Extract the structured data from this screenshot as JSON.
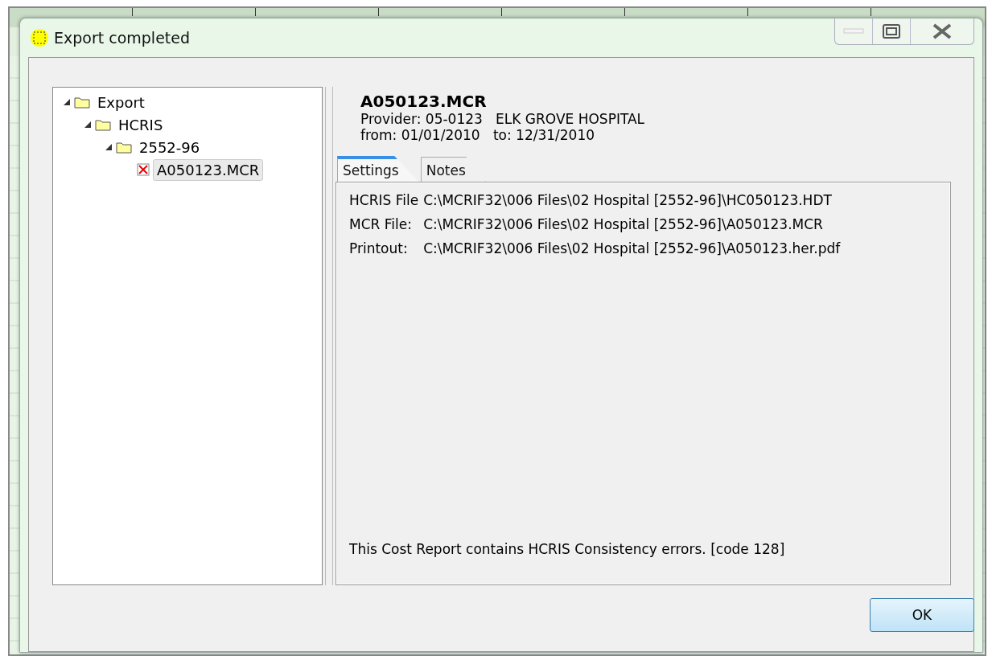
{
  "window": {
    "title": "Export completed"
  },
  "tree": [
    {
      "label": "Export",
      "kind": "folder",
      "expanded": true,
      "selected": false,
      "children": [
        {
          "label": "HCRIS",
          "kind": "folder",
          "expanded": true,
          "selected": false,
          "children": [
            {
              "label": "2552-96",
              "kind": "folder",
              "expanded": true,
              "selected": false,
              "children": [
                {
                  "label": "A050123.MCR",
                  "kind": "error-file",
                  "selected": true
                }
              ]
            }
          ]
        }
      ]
    }
  ],
  "header": {
    "filename": "A050123.MCR",
    "provider": "Provider: 05-0123   ELK GROVE HOSPITAL",
    "period": "from: 01/01/2010   to: 12/31/2010"
  },
  "tabs": [
    {
      "label": "Settings",
      "selected": true
    },
    {
      "label": "Notes",
      "selected": false
    }
  ],
  "settings": [
    {
      "label": "HCRIS File",
      "value": "C:\\MCRIF32\\006 Files\\02 Hospital [2552-96]\\HC050123.HDT"
    },
    {
      "label": "MCR File:",
      "value": "C:\\MCRIF32\\006 Files\\02 Hospital [2552-96]\\A050123.MCR"
    },
    {
      "label": "Printout:",
      "value": "C:\\MCRIF32\\006 Files\\02 Hospital [2552-96]\\A050123.her.pdf"
    }
  ],
  "message": "This Cost Report contains HCRIS Consistency errors. [code 128]",
  "buttons": [
    "OK"
  ]
}
